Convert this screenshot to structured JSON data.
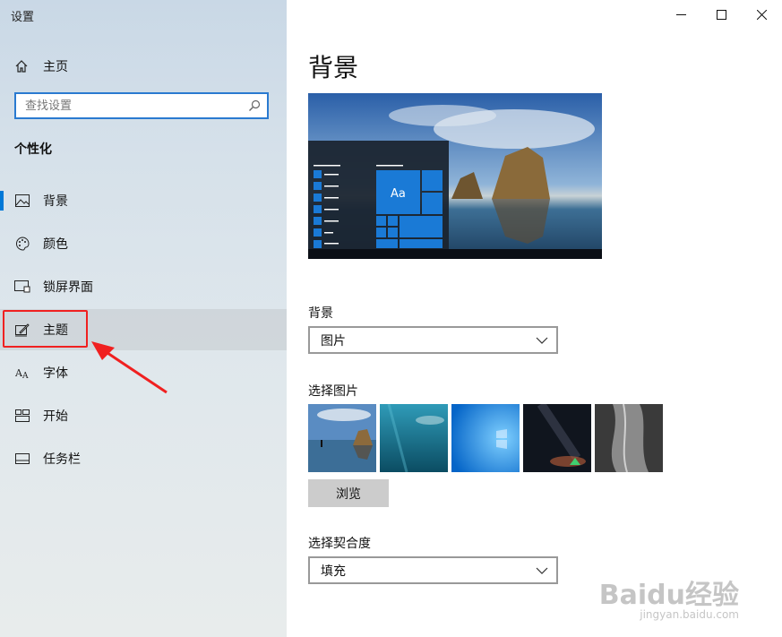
{
  "window": {
    "title": "设置"
  },
  "sidebar": {
    "home_label": "主页",
    "search_placeholder": "查找设置",
    "section_title": "个性化",
    "items": [
      {
        "label": "背景",
        "icon": "picture-icon",
        "active": true
      },
      {
        "label": "颜色",
        "icon": "palette-icon"
      },
      {
        "label": "锁屏界面",
        "icon": "lock-screen-icon"
      },
      {
        "label": "主题",
        "icon": "theme-brush-icon",
        "hover": true
      },
      {
        "label": "字体",
        "icon": "font-icon"
      },
      {
        "label": "开始",
        "icon": "start-tiles-icon"
      },
      {
        "label": "任务栏",
        "icon": "taskbar-icon"
      }
    ]
  },
  "main": {
    "title": "背景",
    "preview_tile_text": "Aa",
    "background_label": "背景",
    "background_value": "图片",
    "choose_picture_label": "选择图片",
    "browse_label": "浏览",
    "fit_label": "选择契合度",
    "fit_value": "填充"
  },
  "watermark": {
    "text": "Baidu经验",
    "sub": "jingyan.baidu.com"
  },
  "colors": {
    "accent": "#0078d7",
    "annotation": "#f02020"
  }
}
